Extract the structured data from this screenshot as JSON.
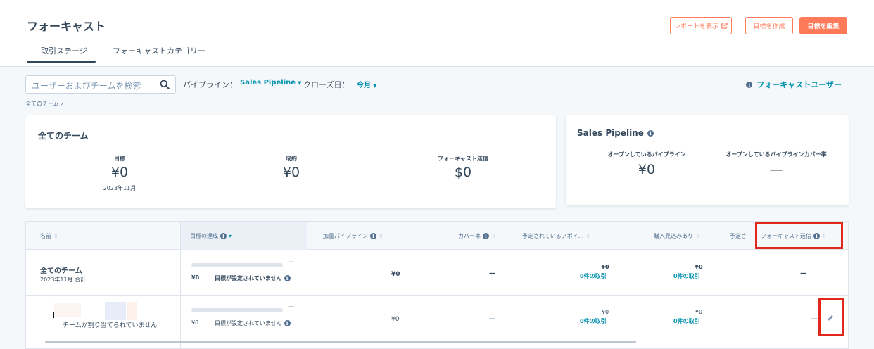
{
  "header": {
    "title": "フォーキャスト",
    "buttons": {
      "show_report": "レポートを表示",
      "create_goal": "目標を作成",
      "edit_goal": "目標を編集"
    },
    "tabs": [
      "取引ステージ",
      "フォーキャストカテゴリー"
    ]
  },
  "filters": {
    "search_placeholder": "ユーザーおよびチームを検索",
    "pipeline_label": "パイプライン：",
    "pipeline_value": "Sales Pipeline",
    "close_date_label": "クローズ日：",
    "close_date_value": "今月",
    "forecast_users": "フォーキャストユーザー",
    "breadcrumb": "全てのチーム ›"
  },
  "summary_card": {
    "title": "全てのチーム",
    "stats": [
      {
        "label": "目標",
        "value": "¥0",
        "sub": "2023年11月"
      },
      {
        "label": "成約",
        "value": "¥0",
        "sub": ""
      },
      {
        "label": "フォーキャスト送信",
        "value": "$0",
        "sub": ""
      }
    ]
  },
  "pipeline_card": {
    "title": "Sales Pipeline",
    "stats": [
      {
        "label": "オープンしているパイプライン",
        "value": "¥0"
      },
      {
        "label": "オープンしているパイプラインカバー率",
        "value": "—"
      }
    ]
  },
  "table": {
    "columns": [
      "名前",
      "目標の達成",
      "加重パイプライン",
      "カバー率",
      "予定されているアポイ...",
      "購入見込みあり",
      "予定さ",
      "フォーキャスト送信"
    ],
    "rows": [
      {
        "name": "全てのチーム",
        "sub": "2023年11月 合計",
        "goal_amount": "¥0",
        "goal_status": "目標が設定されていません",
        "goal_dash": "—",
        "weighted": "¥0",
        "coverage": "—",
        "scheduled_amount": "¥0",
        "scheduled_deals": "0件の取引",
        "likely_amount": "¥0",
        "likely_deals": "0件の取引",
        "forecast": "—"
      },
      {
        "name": "チームが割り当てられていません",
        "goal_amount": "¥0",
        "goal_status": "目標が設定されていません",
        "goal_dash": "—",
        "weighted": "¥0",
        "coverage": "—",
        "scheduled_amount": "¥0",
        "scheduled_deals": "0件の取引",
        "likely_amount": "¥0",
        "likely_deals": "0件の取引",
        "forecast": "—"
      }
    ]
  },
  "icons": {
    "external": "external-link-icon",
    "search": "search-icon",
    "info": "info-icon",
    "edit": "pencil-icon"
  },
  "colors": {
    "accent": "#ff7a59",
    "link": "#0091ae",
    "text": "#33475b",
    "highlight": "#e1261c"
  }
}
